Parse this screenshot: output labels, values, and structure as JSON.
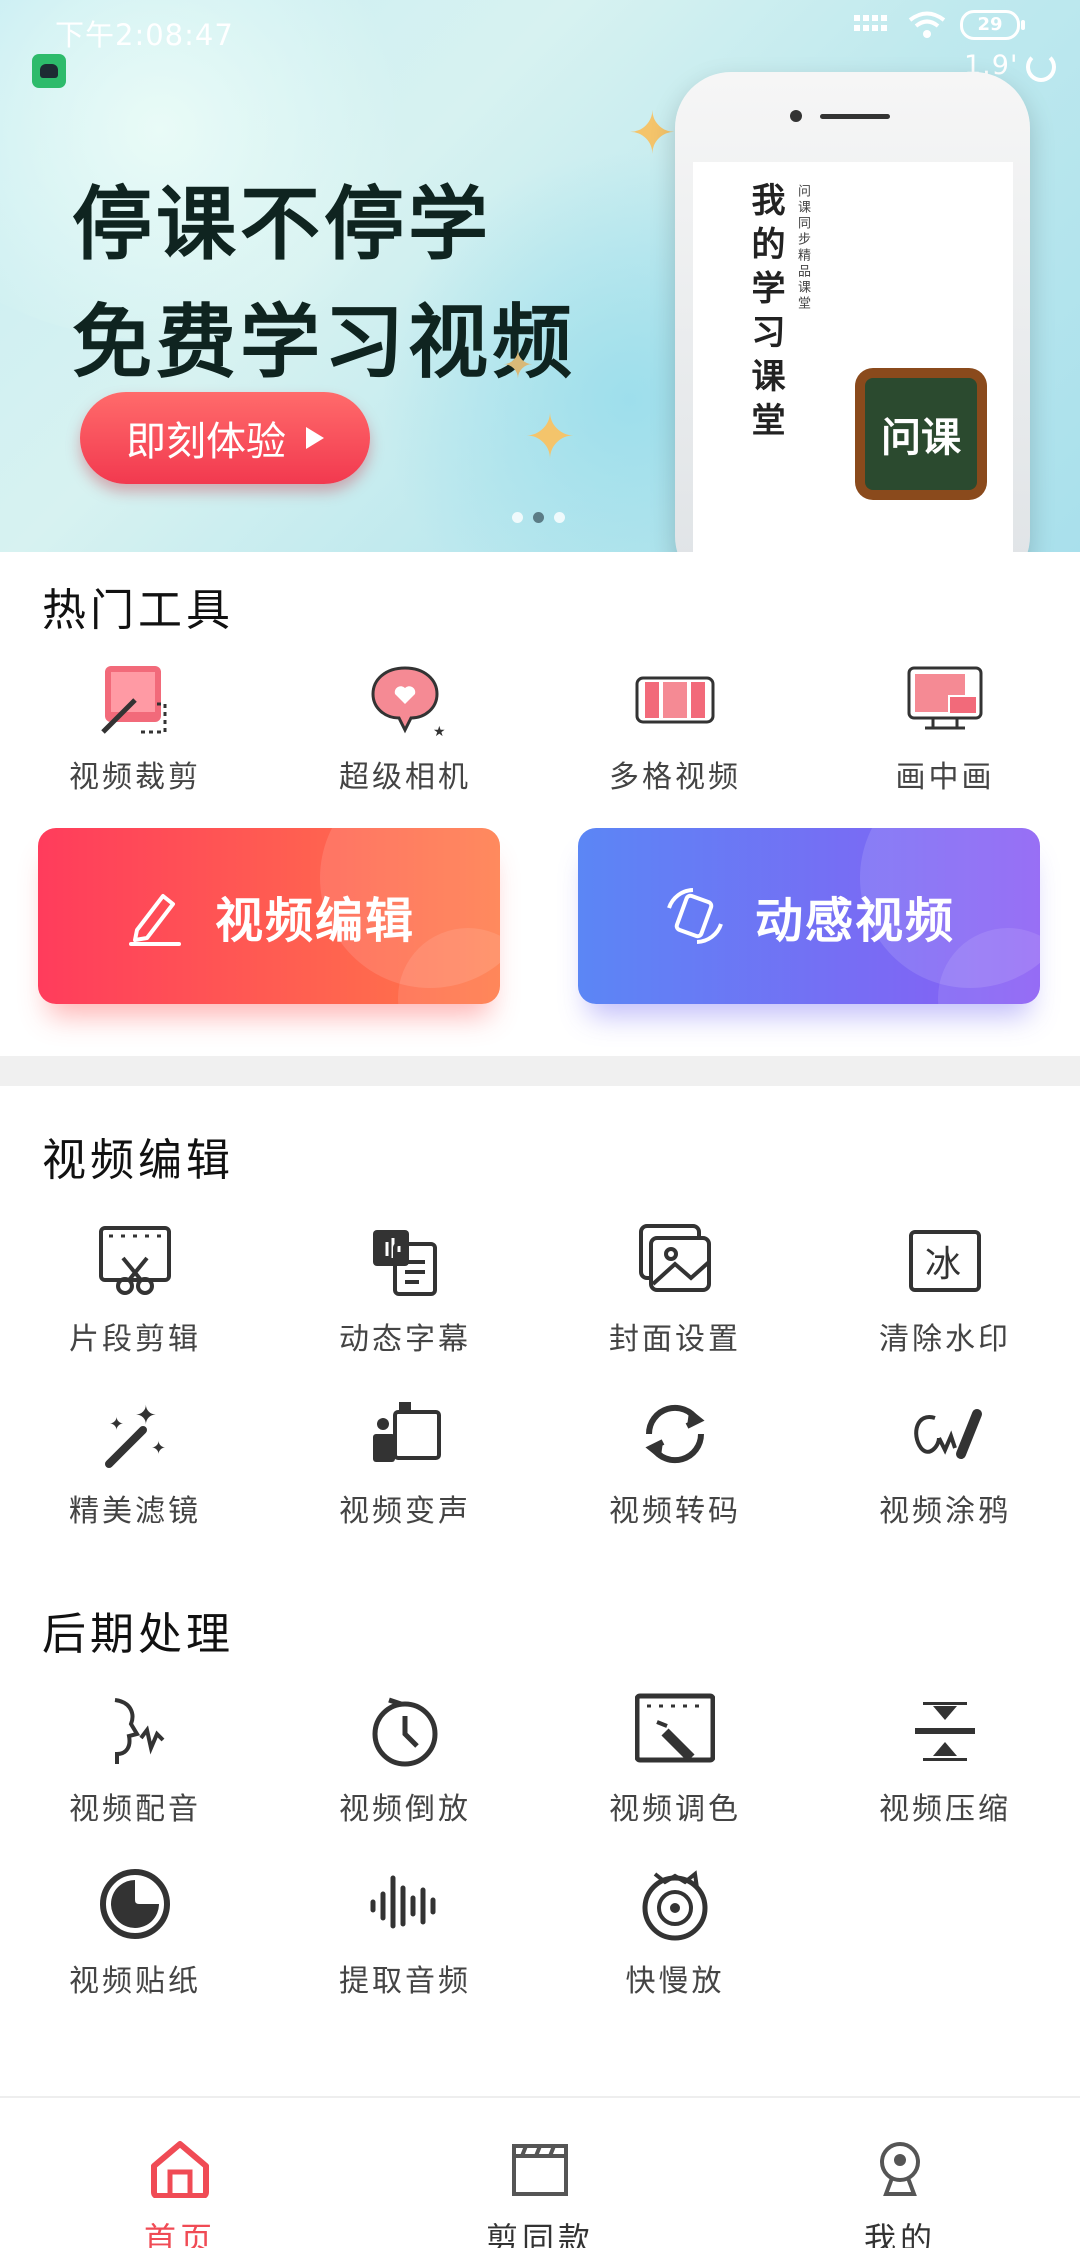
{
  "status_bar": {
    "time": "下午2:08:47",
    "battery": "29",
    "speed": "1.9'"
  },
  "banner": {
    "headline_1": "停课不停学",
    "headline_2": "免费学习视频",
    "cta_label": "即刻体验",
    "phone_title": "我的学习课堂",
    "phone_subtitle": "问课同步精品课堂",
    "board_text": "问课",
    "pager": {
      "count": 3,
      "active_index": 1
    }
  },
  "hot_tools": {
    "title": "热门工具",
    "items": [
      {
        "label": "视频裁剪",
        "icon": "crop-icon"
      },
      {
        "label": "超级相机",
        "icon": "heart-camera-icon"
      },
      {
        "label": "多格视频",
        "icon": "multi-grid-icon"
      },
      {
        "label": "画中画",
        "icon": "picture-in-picture-icon"
      }
    ]
  },
  "primary_actions": {
    "edit_label": "视频编辑",
    "dynamic_label": "动感视频"
  },
  "video_edit": {
    "title": "视频编辑",
    "items": [
      {
        "label": "片段剪辑",
        "icon": "clip-scissors-icon"
      },
      {
        "label": "动态字幕",
        "icon": "subtitle-icon"
      },
      {
        "label": "封面设置",
        "icon": "cover-image-icon"
      },
      {
        "label": "清除水印",
        "icon": "watermark-icon"
      },
      {
        "label": "精美滤镜",
        "icon": "magic-wand-icon"
      },
      {
        "label": "视频变声",
        "icon": "voice-change-icon"
      },
      {
        "label": "视频转码",
        "icon": "convert-icon"
      },
      {
        "label": "视频涂鸦",
        "icon": "doodle-pen-icon"
      }
    ]
  },
  "post_processing": {
    "title": "后期处理",
    "items": [
      {
        "label": "视频配音",
        "icon": "dubbing-icon"
      },
      {
        "label": "视频倒放",
        "icon": "reverse-clock-icon"
      },
      {
        "label": "视频调色",
        "icon": "color-adjust-icon"
      },
      {
        "label": "视频压缩",
        "icon": "compress-icon"
      },
      {
        "label": "视频贴纸",
        "icon": "sticker-icon"
      },
      {
        "label": "提取音频",
        "icon": "audio-wave-icon"
      },
      {
        "label": "快慢放",
        "icon": "speed-disc-icon"
      }
    ]
  },
  "bottom_nav": {
    "items": [
      {
        "label": "首页",
        "icon": "home-icon"
      },
      {
        "label": "剪同款",
        "icon": "clapper-icon"
      },
      {
        "label": "我的",
        "icon": "profile-icon"
      }
    ]
  }
}
